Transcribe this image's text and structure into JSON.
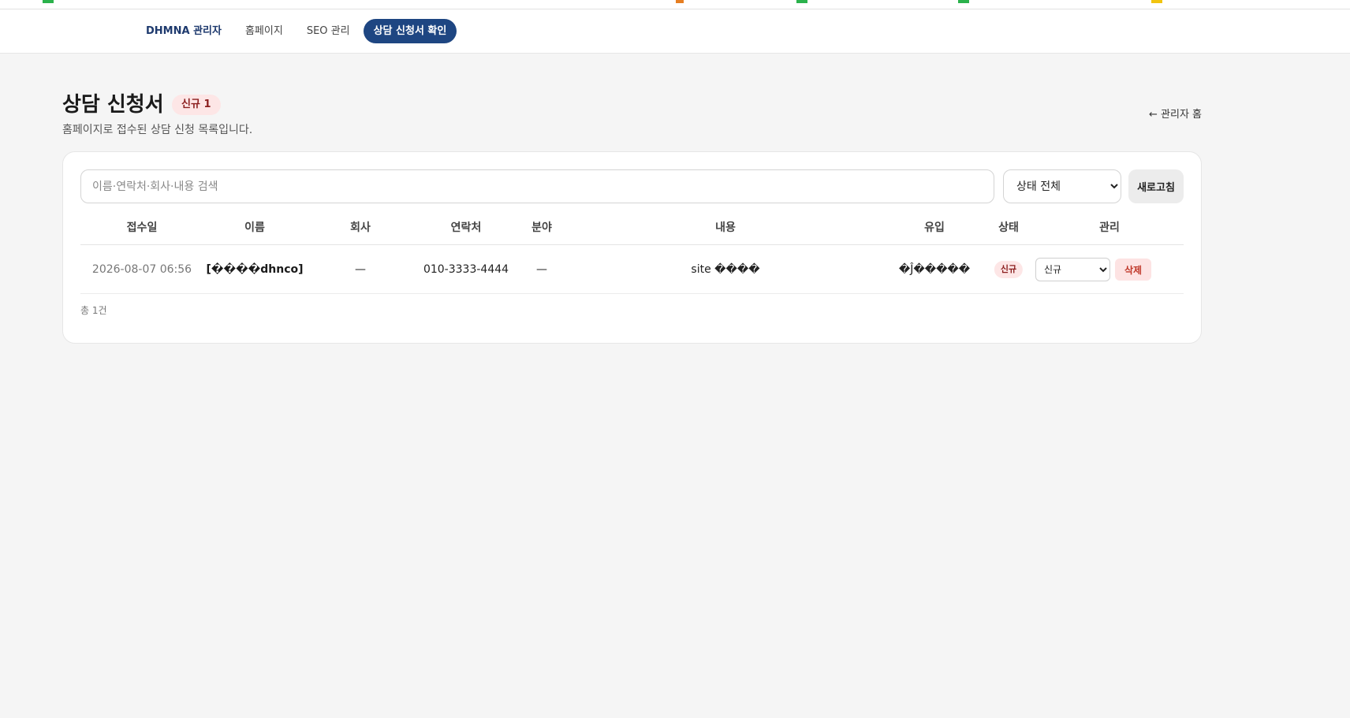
{
  "nav": {
    "brand": "DHMNA 관리자",
    "items": [
      "홈페이지",
      "SEO 관리",
      "상담 신청서 확인"
    ],
    "active_index": 2
  },
  "header": {
    "title": "상담 신청서",
    "badge": "신규 1",
    "subtitle": "홈페이지로 접수된 상담 신청 목록입니다.",
    "back_link": "← 관리자 홈"
  },
  "toolbar": {
    "search_placeholder": "이름·연락처·회사·내용 검색",
    "status_filter_selected": "상태 전체",
    "refresh_label": "새로고침"
  },
  "table": {
    "columns": [
      "접수일",
      "이름",
      "회사",
      "연락처",
      "분야",
      "내용",
      "유입",
      "상태",
      "관리"
    ],
    "rows": [
      {
        "date": "2026-08-07 06:56",
        "name": "[����dhnco]",
        "company": "—",
        "phone": "010-3333-4444",
        "field": "—",
        "content": "site ����",
        "source": "�Ĵ�����",
        "status": "신규",
        "status_select": "신규",
        "delete_label": "삭제"
      }
    ]
  },
  "footer": {
    "total": "총 1건"
  },
  "colors": {
    "primary": "#1e4682",
    "badge_bg": "#fde6e6",
    "badge_text": "#8b1e1e",
    "danger": "#c0392b"
  }
}
